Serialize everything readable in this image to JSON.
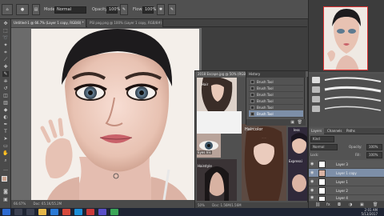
{
  "options_bar": {
    "mode_label": "Mode:",
    "mode_value": "Normal",
    "opacity_label": "Opacity:",
    "opacity_value": "100%",
    "flow_label": "Flow:",
    "flow_value": "100%"
  },
  "tabs": [
    {
      "label": "Untitled-1 @ 66.7% (Layer 1 copy, RGB/8) *",
      "active": true
    },
    {
      "label": "PSI pag.png @ 100% (Layer 1 copy, RGB/8#) *",
      "active": false
    }
  ],
  "canvas_status": {
    "zoom": "66.67%",
    "doc": "Doc: 65.1K/55.2M"
  },
  "float_doc": {
    "title": "2018 Escape.jpg @ 50% (RGB/8)",
    "zoom": "50%",
    "doc": "Doc: 1.56M/1.56M"
  },
  "ref_labels": {
    "hair": "Hair",
    "haircolor": "Haircolor",
    "eyes": "Eyes Iris",
    "hairstyle": "Hairstyle",
    "expression": "Expressi",
    "less": "less"
  },
  "history": {
    "title": "History",
    "items": [
      {
        "label": "Brush Tool",
        "selected": false
      },
      {
        "label": "Brush Tool",
        "selected": false
      },
      {
        "label": "Brush Tool",
        "selected": false
      },
      {
        "label": "Brush Tool",
        "selected": false
      },
      {
        "label": "Brush Tool",
        "selected": false
      },
      {
        "label": "Brush Tool",
        "selected": true
      }
    ]
  },
  "layers_panel": {
    "tabs": [
      "Layers",
      "Channels",
      "Paths"
    ],
    "kind_label": "Kind",
    "blend_mode": "Normal",
    "opacity_label": "Opacity:",
    "opacity_value": "100%",
    "lock_label": "Lock:",
    "fill_label": "Fill:",
    "fill_value": "100%",
    "layers": [
      {
        "name": "Layer 3",
        "selected": false
      },
      {
        "name": "Layer 1 copy",
        "selected": true
      },
      {
        "name": "Layer 1",
        "selected": false
      },
      {
        "name": "Layer 2",
        "selected": false
      },
      {
        "name": "Layer 4",
        "selected": false
      }
    ]
  },
  "taskbar": {
    "time": "2:01 AM",
    "date": "5/13/2017"
  },
  "colors": {
    "selection": "#7d8fa8",
    "panel": "#535353",
    "taskbar": "#1e2433"
  }
}
